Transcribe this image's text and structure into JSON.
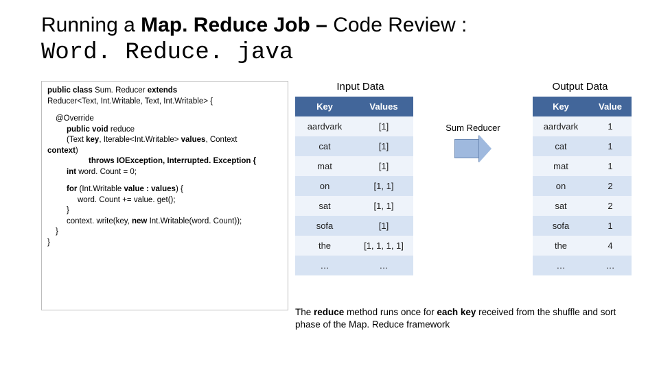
{
  "title": {
    "pre": "Running a ",
    "bold1": "Map. Reduce Job – ",
    "post": "Code Review : ",
    "mono": "Word. Reduce. java"
  },
  "labels": {
    "input": "Input Data",
    "output": "Output Data"
  },
  "code": {
    "l1a": "public class ",
    "l1b": "Sum. Reducer ",
    "l1c": "extends",
    "l2": "Reducer<Text, Int.Writable, Text, Int.Writable> {",
    "l3": "@Override",
    "l4a": "public void ",
    "l4b": "reduce",
    "l5a": "(Text ",
    "l5b": "key",
    "l5c": ", Iterable<Int.Writable> ",
    "l5d": "values",
    "l5e": ", Context",
    "l6a": "context",
    "l6b": ")",
    "l7": "throws IOException, Interrupted. Exception {",
    "l8a": "int ",
    "l8b": "word. Count = 0;",
    "l9a": "for ",
    "l9b": "(Int.Writable ",
    "l9c": "value : values",
    "l9d": ") {",
    "l10": "word. Count += value. get();",
    "l11": "}",
    "l12a": "context. write(key, ",
    "l12b": "new ",
    "l12c": "Int.Writable(word. Count));",
    "l13": "}",
    "l14": "}"
  },
  "input_table": {
    "h1": "Key",
    "h2": "Values",
    "rows": [
      {
        "k": "aardvark",
        "v": "[1]"
      },
      {
        "k": "cat",
        "v": "[1]"
      },
      {
        "k": "mat",
        "v": "[1]"
      },
      {
        "k": "on",
        "v": "[1, 1]"
      },
      {
        "k": "sat",
        "v": "[1, 1]"
      },
      {
        "k": "sofa",
        "v": "[1]"
      },
      {
        "k": "the",
        "v": "[1, 1, 1, 1]"
      },
      {
        "k": "…",
        "v": "…"
      }
    ]
  },
  "reducer_label": "Sum Reducer",
  "output_table": {
    "h1": "Key",
    "h2": "Value",
    "rows": [
      {
        "k": "aardvark",
        "v": "1"
      },
      {
        "k": "cat",
        "v": "1"
      },
      {
        "k": "mat",
        "v": "1"
      },
      {
        "k": "on",
        "v": "2"
      },
      {
        "k": "sat",
        "v": "2"
      },
      {
        "k": "sofa",
        "v": "1"
      },
      {
        "k": "the",
        "v": "4"
      },
      {
        "k": "…",
        "v": "…"
      }
    ]
  },
  "footnote": {
    "p1": "The ",
    "b1": "reduce ",
    "p2": "method runs once for ",
    "b2": "each key ",
    "p3": "received from the shuffle and sort phase of the Map. Reduce framework"
  }
}
